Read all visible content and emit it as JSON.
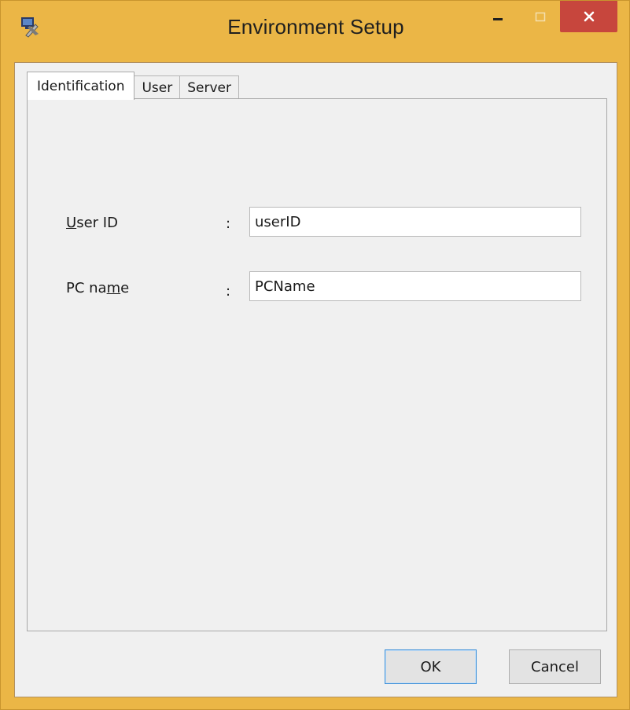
{
  "window": {
    "title": "Environment Setup",
    "icon": "app-tools-icon",
    "accent_color": "#ebb646",
    "close_color": "#c7463d",
    "controls": {
      "minimize": "minimize-icon",
      "maximize": "maximize-icon",
      "close": "close-icon"
    }
  },
  "tabs": [
    {
      "label": "Identification",
      "active": true
    },
    {
      "label": "User",
      "active": false
    },
    {
      "label": "Server",
      "active": false
    }
  ],
  "form": {
    "user_id": {
      "label_prefix": "U",
      "label_rest": "ser ID",
      "separator": ":",
      "value": "userID"
    },
    "pc_name": {
      "label_prefix": "PC na",
      "label_mnemonic": "m",
      "label_rest": "e",
      "separator": ":",
      "value": "PCName"
    }
  },
  "buttons": {
    "ok": "OK",
    "cancel": "Cancel"
  }
}
